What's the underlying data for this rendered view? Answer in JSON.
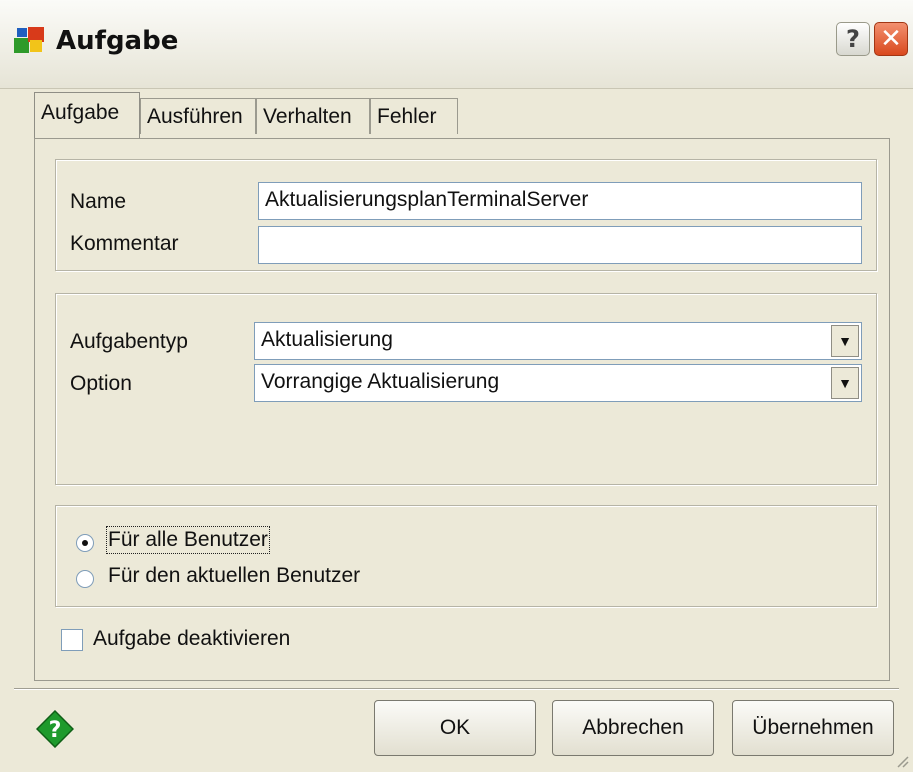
{
  "window": {
    "title": "Aufgabe",
    "help_glyph": "?",
    "close_glyph": "✕",
    "icon": "app-icon"
  },
  "tabs": [
    {
      "label": "Aufgabe",
      "active": true
    },
    {
      "label": "Ausführen",
      "active": false
    },
    {
      "label": "Verhalten",
      "active": false
    },
    {
      "label": "Fehler",
      "active": false
    }
  ],
  "general": {
    "name_label": "Name",
    "name_value": "AktualisierungsplanTerminalServer",
    "comment_label": "Kommentar",
    "comment_value": ""
  },
  "type": {
    "type_label": "Aufgabentyp",
    "type_value": "Aktualisierung",
    "option_label": "Option",
    "option_value": "Vorrangige Aktualisierung"
  },
  "scope": {
    "all_users_label": "Für alle Benutzer",
    "all_users_selected": true,
    "current_user_label": "Für den aktuellen Benutzer",
    "current_user_selected": false
  },
  "disable": {
    "label": "Aufgabe deaktivieren",
    "checked": false
  },
  "buttons": {
    "ok": "OK",
    "cancel": "Abbrechen",
    "apply": "Übernehmen"
  },
  "colors": {
    "dialog_bg": "#ece9d8",
    "close_red": "#d9491e",
    "help_green": "#1e9a2c"
  }
}
